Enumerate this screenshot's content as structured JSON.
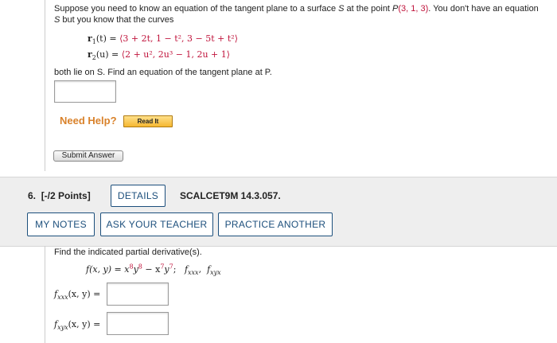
{
  "q5": {
    "intro_a": "Suppose you need to know an equation of the tangent plane to a surface ",
    "intro_s": "S",
    "intro_b": " at the point ",
    "intro_p": "P",
    "intro_point": "(3, 1, 3)",
    "intro_c": ". You don't have an equation",
    "line2_s": "S",
    "line2_rest": " but you know that the curves",
    "r1_lhs": "r",
    "r1_sub": "1",
    "r1_arg": "(t) = ",
    "r1_rhs": "⟨3 + 2t, 1 − t², 3 − 5t + t²⟩",
    "r2_lhs": "r",
    "r2_sub": "2",
    "r2_arg": "(u) = ",
    "r2_rhs": "⟨2 + u², 2u³ − 1, 2u + 1⟩",
    "both_lie": "both lie on S. Find an equation of the tangent plane at P.",
    "need_help": "Need Help?",
    "read_it": "Read It",
    "submit": "Submit Answer"
  },
  "q6": {
    "number": "6.",
    "points": "[-/2 Points]",
    "details": "DETAILS",
    "code": "SCALCET9M 14.3.057.",
    "my_notes": "MY NOTES",
    "ask_teacher": "ASK YOUR TEACHER",
    "practice": "PRACTICE ANOTHER",
    "instruction": "Find the indicated partial derivative(s).",
    "func_lhs": "f(x, y) = x",
    "func_exp1": "8",
    "func_y": "y",
    "func_exp2": "8",
    "func_minus": " − x",
    "func_exp3": "7",
    "func_y2": "y",
    "func_exp4": "7",
    "func_semi": ";",
    "f1": "f",
    "f1_sub": "xxx",
    "comma": ",",
    "f2": "f",
    "f2_sub": "xyx",
    "label1_f": "f",
    "label1_sub": "xxx",
    "label1_rest": "(x, y) =",
    "label2_f": "f",
    "label2_sub": "xyx",
    "label2_rest": "(x, y) ="
  }
}
